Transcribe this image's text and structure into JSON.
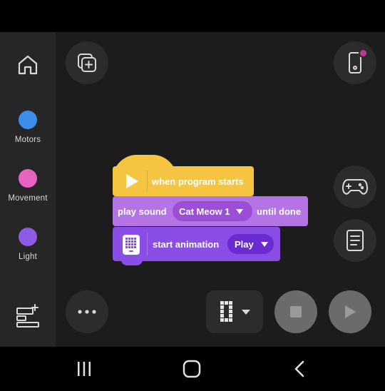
{
  "sidebar": {
    "home_icon": "home-icon",
    "categories": [
      {
        "label": "Motors",
        "color": "#3d8ee8"
      },
      {
        "label": "Movement",
        "color": "#e863c0"
      },
      {
        "label": "Light",
        "color": "#8e5be6"
      }
    ],
    "extensions_icon": "add-extension-icon"
  },
  "toolbar": {
    "add_project_icon": "add-copy-icon",
    "device_icon": "hub-icon",
    "device_status_color": "#c3379c",
    "more_icon": "more-icon",
    "controller_icon": "gamepad-icon",
    "notes_icon": "notes-icon"
  },
  "blocks": {
    "hat": {
      "text": "when program starts",
      "color": "#f5c542"
    },
    "sound": {
      "prefix": "play sound",
      "sound_name": "Cat Meow 1",
      "suffix": "until done",
      "color": "#b474e6"
    },
    "animation": {
      "text": "start animation",
      "animation_name": "Play",
      "color": "#8a4ee6"
    }
  },
  "controls": {
    "matrix_icon": "light-matrix-icon",
    "stop_icon": "stop-icon",
    "run_icon": "play-icon"
  },
  "nav": {
    "recents_icon": "recents-icon",
    "home_icon": "circle-home-icon",
    "back_icon": "back-icon"
  }
}
